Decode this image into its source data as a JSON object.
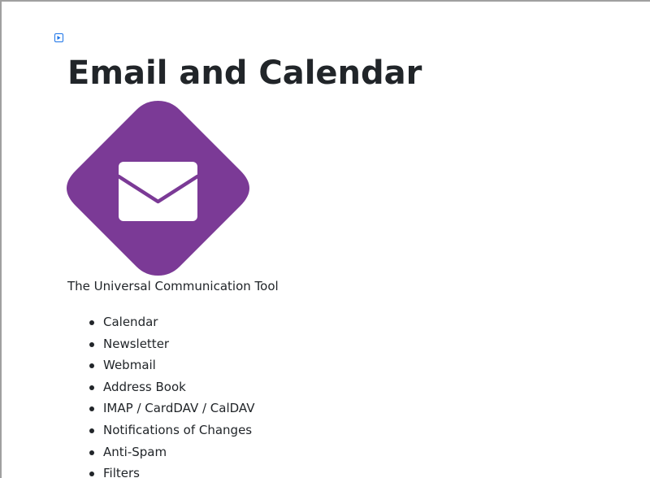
{
  "page": {
    "title": "Email and Calendar",
    "tagline": "The Universal Communication Tool"
  },
  "toggle": {
    "icon": "expand-toggle-icon"
  },
  "logo": {
    "icon": "envelope-icon",
    "background_color": "#7b3a96",
    "envelope_color": "#ffffff"
  },
  "features": [
    {
      "label": "Calendar"
    },
    {
      "label": "Newsletter"
    },
    {
      "label": "Webmail"
    },
    {
      "label": "Address Book"
    },
    {
      "label": "IMAP / CardDAV / CalDAV"
    },
    {
      "label": "Notifications of Changes"
    },
    {
      "label": "Anti-Spam"
    },
    {
      "label": "Filters"
    }
  ],
  "colors": {
    "text": "#212529",
    "accent": "#1a73e8"
  }
}
